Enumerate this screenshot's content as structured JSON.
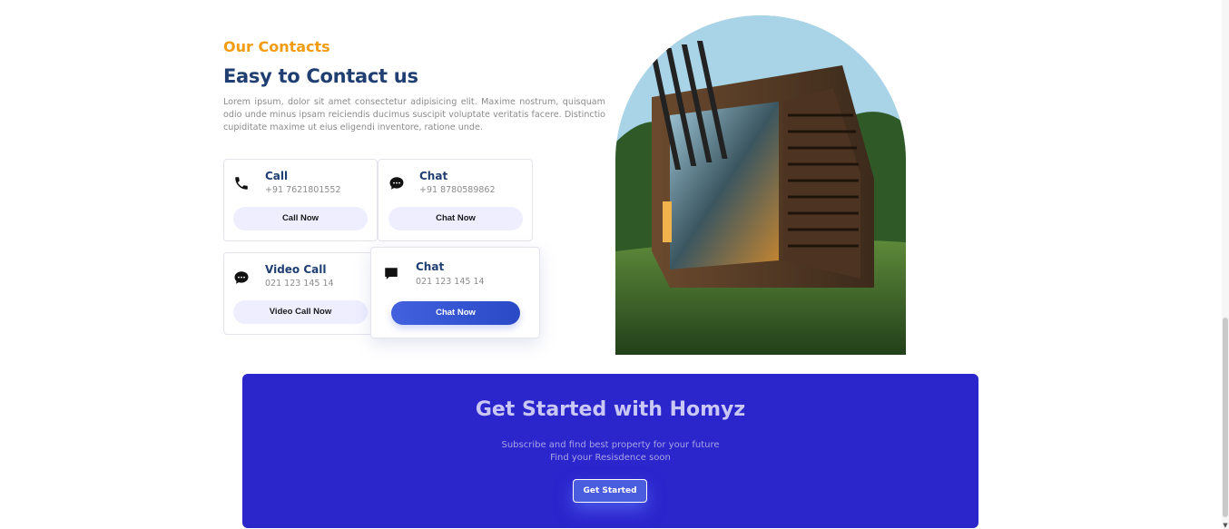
{
  "contacts": {
    "eyebrow": "Our Contacts",
    "title": "Easy to Contact us",
    "description": "Lorem ipsum, dolor sit amet consectetur adipisicing elit. Maxime nostrum, quisquam odio unde minus ipsam reiciendis ducimus suscipit voluptate veritatis facere. Distinctio cupiditate maxime ut eius eligendi inventore, ratione unde.",
    "cards": [
      {
        "icon": "phone-icon",
        "title": "Call",
        "number": "+91 7621801552",
        "button": "Call Now"
      },
      {
        "icon": "chat-bubble-icon",
        "title": "Chat",
        "number": "+91 8780589862",
        "button": "Chat Now"
      },
      {
        "icon": "chat-bubble-icon",
        "title": "Video Call",
        "number": "021 123 145 14",
        "button": "Video Call Now"
      },
      {
        "icon": "message-icon",
        "title": "Chat",
        "number": "021 123 145 14",
        "button": "Chat Now"
      }
    ]
  },
  "get_started": {
    "title": "Get Started with Homyz",
    "line1": "Subscribe and find best property for your future",
    "line2": "Find your Resisdence soon",
    "button": "Get Started"
  },
  "colors": {
    "accent_orange": "#f39c12",
    "heading_blue": "#1f3e72",
    "banner_blue": "#2b25cc",
    "button_gradient_start": "#4161df"
  }
}
